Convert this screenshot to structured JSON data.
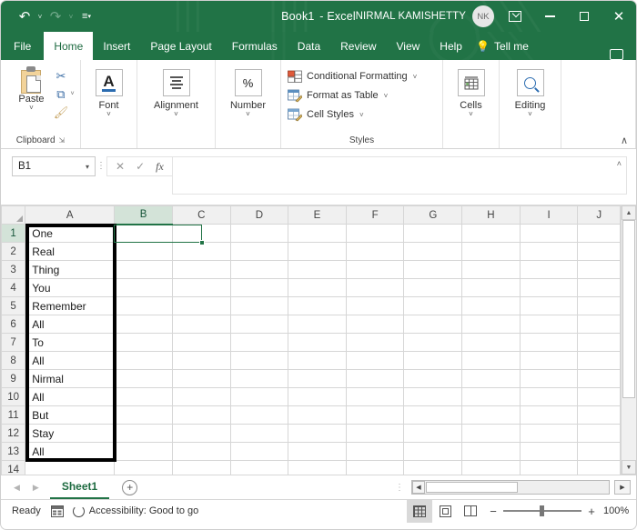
{
  "window": {
    "title_book": "Book1",
    "title_sep": "-",
    "title_app": "Excel",
    "account_name": "NIRMAL KAMISHETTY",
    "account_initials": "NK",
    "ribbon_display_icon": "ribbon-display-options-icon",
    "minimize_icon": "minimize-icon",
    "maximize_icon": "maximize-icon",
    "close_icon": "close-icon",
    "close_glyph": "✕"
  },
  "qat": {
    "undo_glyph": "↶",
    "redo_glyph": "↷",
    "customize_glyph": "☷",
    "caret_glyph": "˅"
  },
  "tabs": [
    {
      "label": "File",
      "active": false
    },
    {
      "label": "Home",
      "active": true
    },
    {
      "label": "Insert",
      "active": false
    },
    {
      "label": "Page Layout",
      "active": false
    },
    {
      "label": "Formulas",
      "active": false
    },
    {
      "label": "Data",
      "active": false
    },
    {
      "label": "Review",
      "active": false
    },
    {
      "label": "View",
      "active": false
    },
    {
      "label": "Help",
      "active": false
    }
  ],
  "tellme": {
    "label": "Tell me",
    "bulb_glyph": "○"
  },
  "ribbon": {
    "clipboard": {
      "group_label": "Clipboard",
      "paste_label": "Paste",
      "caret": "˅",
      "dialog_launcher": "⬌",
      "cut_glyph": "✂",
      "copy_glyph": "⧉",
      "format_painter_glyph": "✐"
    },
    "font": {
      "label": "Font",
      "caret": "˅",
      "icon_letter": "A"
    },
    "alignment": {
      "label": "Alignment",
      "caret": "˅"
    },
    "number": {
      "label": "Number",
      "caret": "˅",
      "icon_glyph": "%"
    },
    "styles": {
      "group_label": "Styles",
      "items": [
        {
          "label": "Conditional Formatting",
          "caret": "˅"
        },
        {
          "label": "Format as Table",
          "caret": "˅"
        },
        {
          "label": "Cell Styles",
          "caret": "˅"
        }
      ]
    },
    "cells": {
      "label": "Cells",
      "caret": "˅"
    },
    "editing": {
      "label": "Editing",
      "caret": "˅"
    },
    "collapse_glyph": "∧"
  },
  "formula_bar": {
    "name_box_value": "B1",
    "name_box_caret": "▾",
    "cancel_glyph": "✕",
    "enter_glyph": "✓",
    "fx_label": "fx",
    "formula_value": "",
    "expand_glyph": "˄"
  },
  "grid": {
    "columns": [
      "A",
      "B",
      "C",
      "D",
      "E",
      "F",
      "G",
      "H",
      "I",
      "J"
    ],
    "selected_column": "B",
    "selected_row": 1,
    "selected_cell": "B1",
    "rows": [
      {
        "num": "1",
        "A": "One"
      },
      {
        "num": "2",
        "A": "Real"
      },
      {
        "num": "3",
        "A": "Thing"
      },
      {
        "num": "4",
        "A": "You"
      },
      {
        "num": "5",
        "A": "Remember"
      },
      {
        "num": "6",
        "A": "All"
      },
      {
        "num": "7",
        "A": "To"
      },
      {
        "num": "8",
        "A": "All"
      },
      {
        "num": "9",
        "A": "Nirmal"
      },
      {
        "num": "10",
        "A": "All"
      },
      {
        "num": "11",
        "A": "But"
      },
      {
        "num": "12",
        "A": "Stay"
      },
      {
        "num": "13",
        "A": "All"
      },
      {
        "num": "14",
        "A": ""
      }
    ],
    "annotation": "left-pointing-arrow-annotation",
    "highlight_border": "column-a-black-outline"
  },
  "scrollbars": {
    "v_up_glyph": "▲",
    "v_down_glyph": "▼",
    "h_left_glyph": "◀",
    "h_right_glyph": "▶"
  },
  "sheet_bar": {
    "prev_glyph": "◀",
    "next_glyph": "▶",
    "sheets": [
      {
        "name": "Sheet1",
        "active": true
      }
    ],
    "add_sheet_glyph": "+",
    "separator_glyph": "⋮"
  },
  "status_bar": {
    "state": "Ready",
    "macro_icon": "record-macro-icon",
    "accessibility": "Accessibility: Good to go",
    "views": [
      {
        "name": "Normal",
        "active": true
      },
      {
        "name": "Page Layout",
        "active": false
      },
      {
        "name": "Page Break Preview",
        "active": false
      }
    ],
    "zoom_minus": "−",
    "zoom_plus": "+",
    "zoom_value": "100%"
  }
}
